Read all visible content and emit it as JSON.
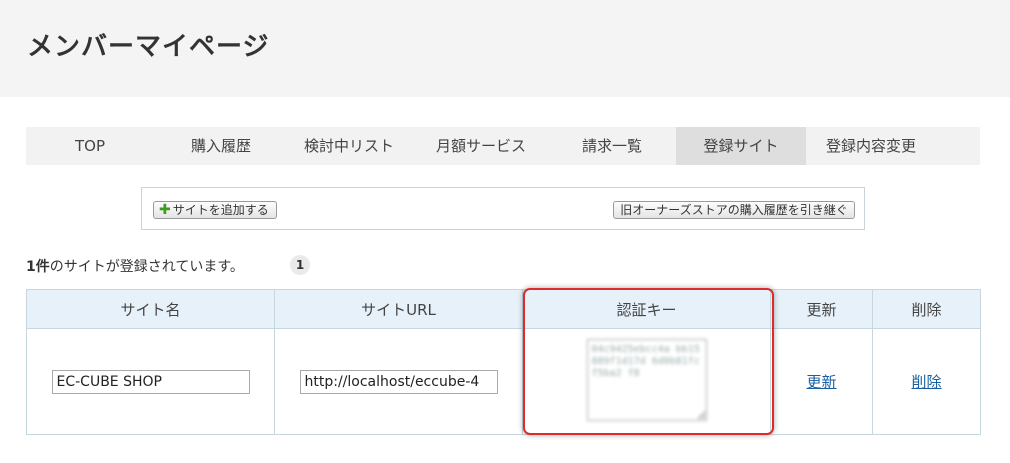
{
  "header": {
    "title": "メンバーマイページ"
  },
  "tabs": [
    {
      "label": "TOP",
      "active": false
    },
    {
      "label": "購入履歴",
      "active": false
    },
    {
      "label": "検討中リスト",
      "active": false
    },
    {
      "label": "月額サービス",
      "active": false
    },
    {
      "label": "請求一覧",
      "active": false
    },
    {
      "label": "登録サイト",
      "active": true
    },
    {
      "label": "登録内容変更",
      "active": false
    }
  ],
  "actions": {
    "add_site": "サイトを追加する",
    "inherit_history": "旧オーナーズストアの購入履歴を引き継ぐ"
  },
  "summary": {
    "count": "1件",
    "text": "のサイトが登録されています。",
    "page": "1"
  },
  "table": {
    "headers": [
      "サイト名",
      "サイトURL",
      "認証キー",
      "更新",
      "削除"
    ],
    "rows": [
      {
        "site_name": "EC-CUBE SHOP",
        "site_url": "http://localhost/eccube-4",
        "auth_key": "04c9425ebcc4a bb15889f1d17d 6d0b81fcf5ba2 f8",
        "update_label": "更新",
        "delete_label": "削除"
      }
    ]
  },
  "colors": {
    "highlight": "#dd2a2a",
    "link": "#1a5fa0",
    "header_bg": "#f4f4f4",
    "table_header_bg": "#e7f1f9"
  }
}
